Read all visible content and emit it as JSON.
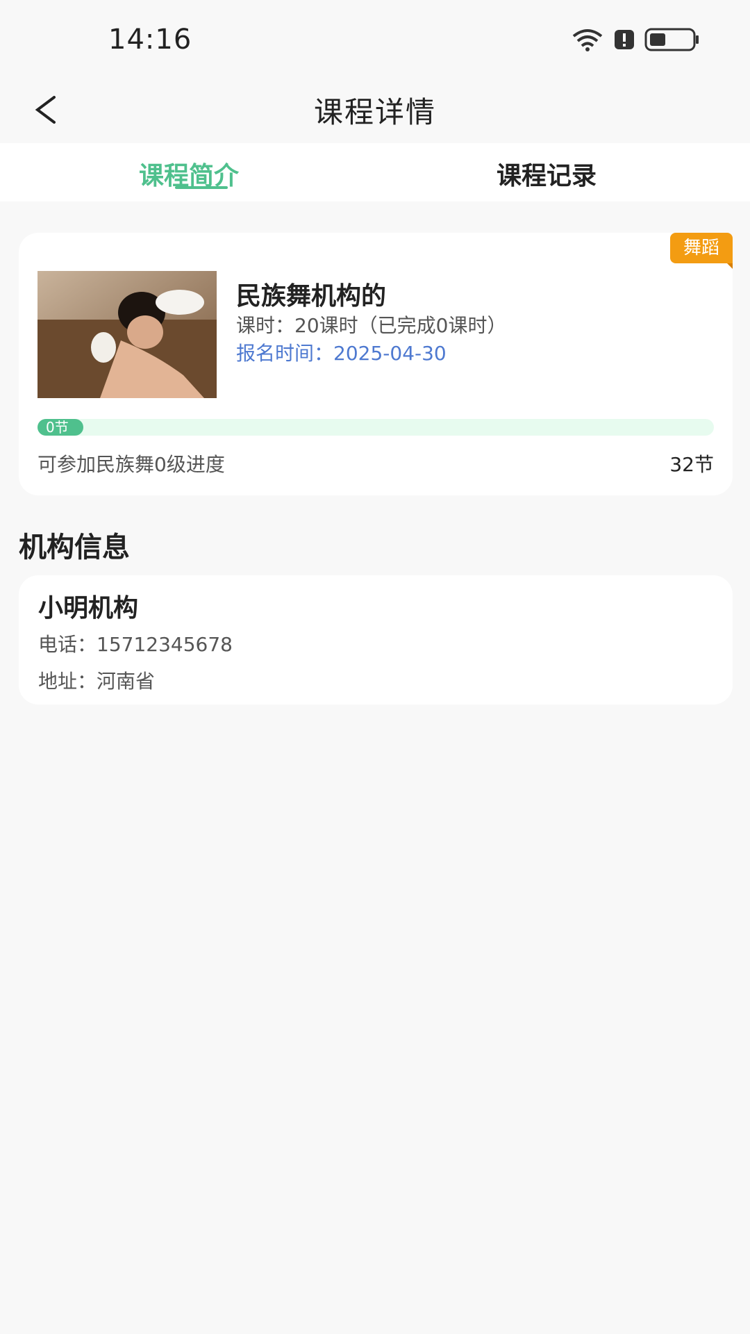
{
  "status_bar": {
    "time": "14:16"
  },
  "header": {
    "title": "课程详情"
  },
  "tabs": [
    {
      "label": "课程简介",
      "active": true
    },
    {
      "label": "课程记录",
      "active": false
    }
  ],
  "course": {
    "tag": "舞蹈",
    "name": "民族舞机构的",
    "hours_text": "课时：20课时（已完成0课时）",
    "enroll_label": "报名时间：",
    "enroll_date": "2025-04-30",
    "progress": {
      "current_label": "0节",
      "current": 0,
      "total": 32,
      "description": "可参加民族舞0级进度",
      "total_label": "32节"
    }
  },
  "org_section": {
    "title": "机构信息",
    "name": "小明机构",
    "phone_label": "电话：",
    "phone": "15712345678",
    "address_label": "地址：",
    "address": "河南省"
  },
  "colors": {
    "accent": "#4fc08d",
    "tag": "#f39c12",
    "link": "#4e79d0"
  }
}
